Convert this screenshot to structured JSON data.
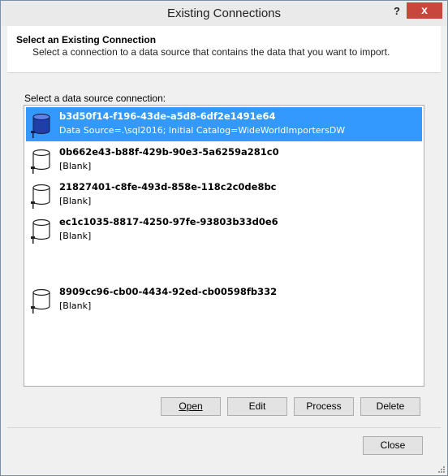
{
  "window": {
    "title": "Existing Connections",
    "help_label": "?",
    "close_label": "x"
  },
  "header": {
    "title": "Select an Existing Connection",
    "subtitle": "Select a connection to a data source that contains the data that you want to import."
  },
  "list": {
    "label": "Select a data source connection:",
    "items": [
      {
        "title": "b3d50f14-f196-43de-a5d8-6df2e1491e64",
        "subtitle": "Data Source=.\\sql2016; Initial Catalog=WideWorldImportersDW",
        "selected": true,
        "icon": "database-icon"
      },
      {
        "title": "0b662e43-b88f-429b-90e3-5a6259a281c0",
        "subtitle": "[Blank]",
        "selected": false,
        "icon": "database-icon"
      },
      {
        "title": "21827401-c8fe-493d-858e-118c2c0de8bc",
        "subtitle": "[Blank]",
        "selected": false,
        "icon": "database-icon"
      },
      {
        "title": "ec1c1035-8817-4250-97fe-93803b33d0e6",
        "subtitle": "[Blank]",
        "selected": false,
        "icon": "database-icon"
      },
      {
        "title": "8909cc96-cb00-4434-92ed-cb00598fb332",
        "subtitle": "[Blank]",
        "selected": false,
        "icon": "database-icon"
      }
    ]
  },
  "buttons": {
    "open": "Open",
    "edit": "Edit",
    "process": "Process",
    "delete": "Delete",
    "close": "Close"
  },
  "colors": {
    "selection": "#3399ff",
    "close_button": "#c9463d"
  }
}
